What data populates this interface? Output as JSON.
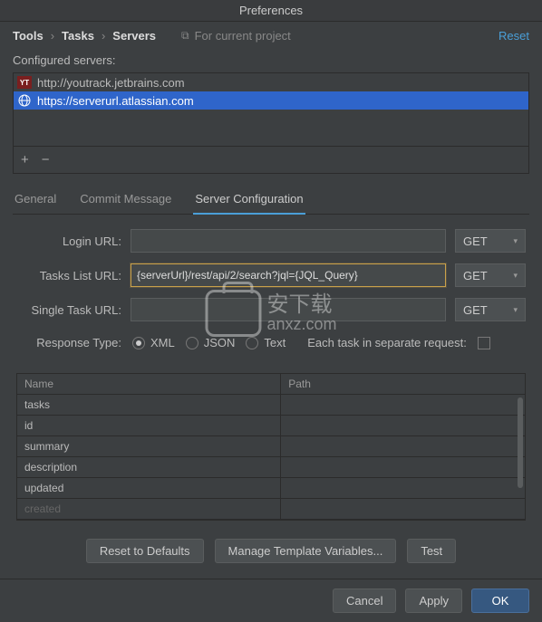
{
  "window": {
    "title": "Preferences"
  },
  "breadcrumb": {
    "items": [
      "Tools",
      "Tasks",
      "Servers"
    ],
    "project_scope": "For current project",
    "reset_label": "Reset"
  },
  "servers": {
    "label": "Configured servers:",
    "items": [
      {
        "icon": "yt",
        "url": "http://youtrack.jetbrains.com",
        "selected": false
      },
      {
        "icon": "globe",
        "url": "https://serverurl.atlassian.com",
        "selected": true
      }
    ],
    "add_tooltip": "+",
    "remove_tooltip": "−"
  },
  "tabs": {
    "items": [
      "General",
      "Commit Message",
      "Server Configuration"
    ],
    "active_index": 2
  },
  "form": {
    "login_url": {
      "label": "Login URL:",
      "value": "",
      "method": "GET"
    },
    "tasks_list_url": {
      "label": "Tasks List URL:",
      "value": "{serverUrl}/rest/api/2/search?jql={JQL_Query}",
      "method": "GET"
    },
    "single_task_url": {
      "label": "Single Task URL:",
      "value": "",
      "method": "GET"
    },
    "response_type": {
      "label": "Response Type:",
      "options": [
        "XML",
        "JSON",
        "Text"
      ],
      "selected": "XML",
      "each_task_label": "Each task in separate request:",
      "each_task_checked": false
    }
  },
  "table": {
    "columns": [
      "Name",
      "Path"
    ],
    "rows": [
      {
        "name": "tasks",
        "path": ""
      },
      {
        "name": "id",
        "path": ""
      },
      {
        "name": "summary",
        "path": ""
      },
      {
        "name": "description",
        "path": ""
      },
      {
        "name": "updated",
        "path": ""
      },
      {
        "name": "created",
        "path": "",
        "fade": true
      }
    ]
  },
  "buttons": {
    "reset_defaults": "Reset to Defaults",
    "manage_templates": "Manage Template Variables...",
    "test": "Test",
    "cancel": "Cancel",
    "apply": "Apply",
    "ok": "OK"
  },
  "watermark": {
    "line1": "安下载",
    "line2": "anxz.com"
  }
}
